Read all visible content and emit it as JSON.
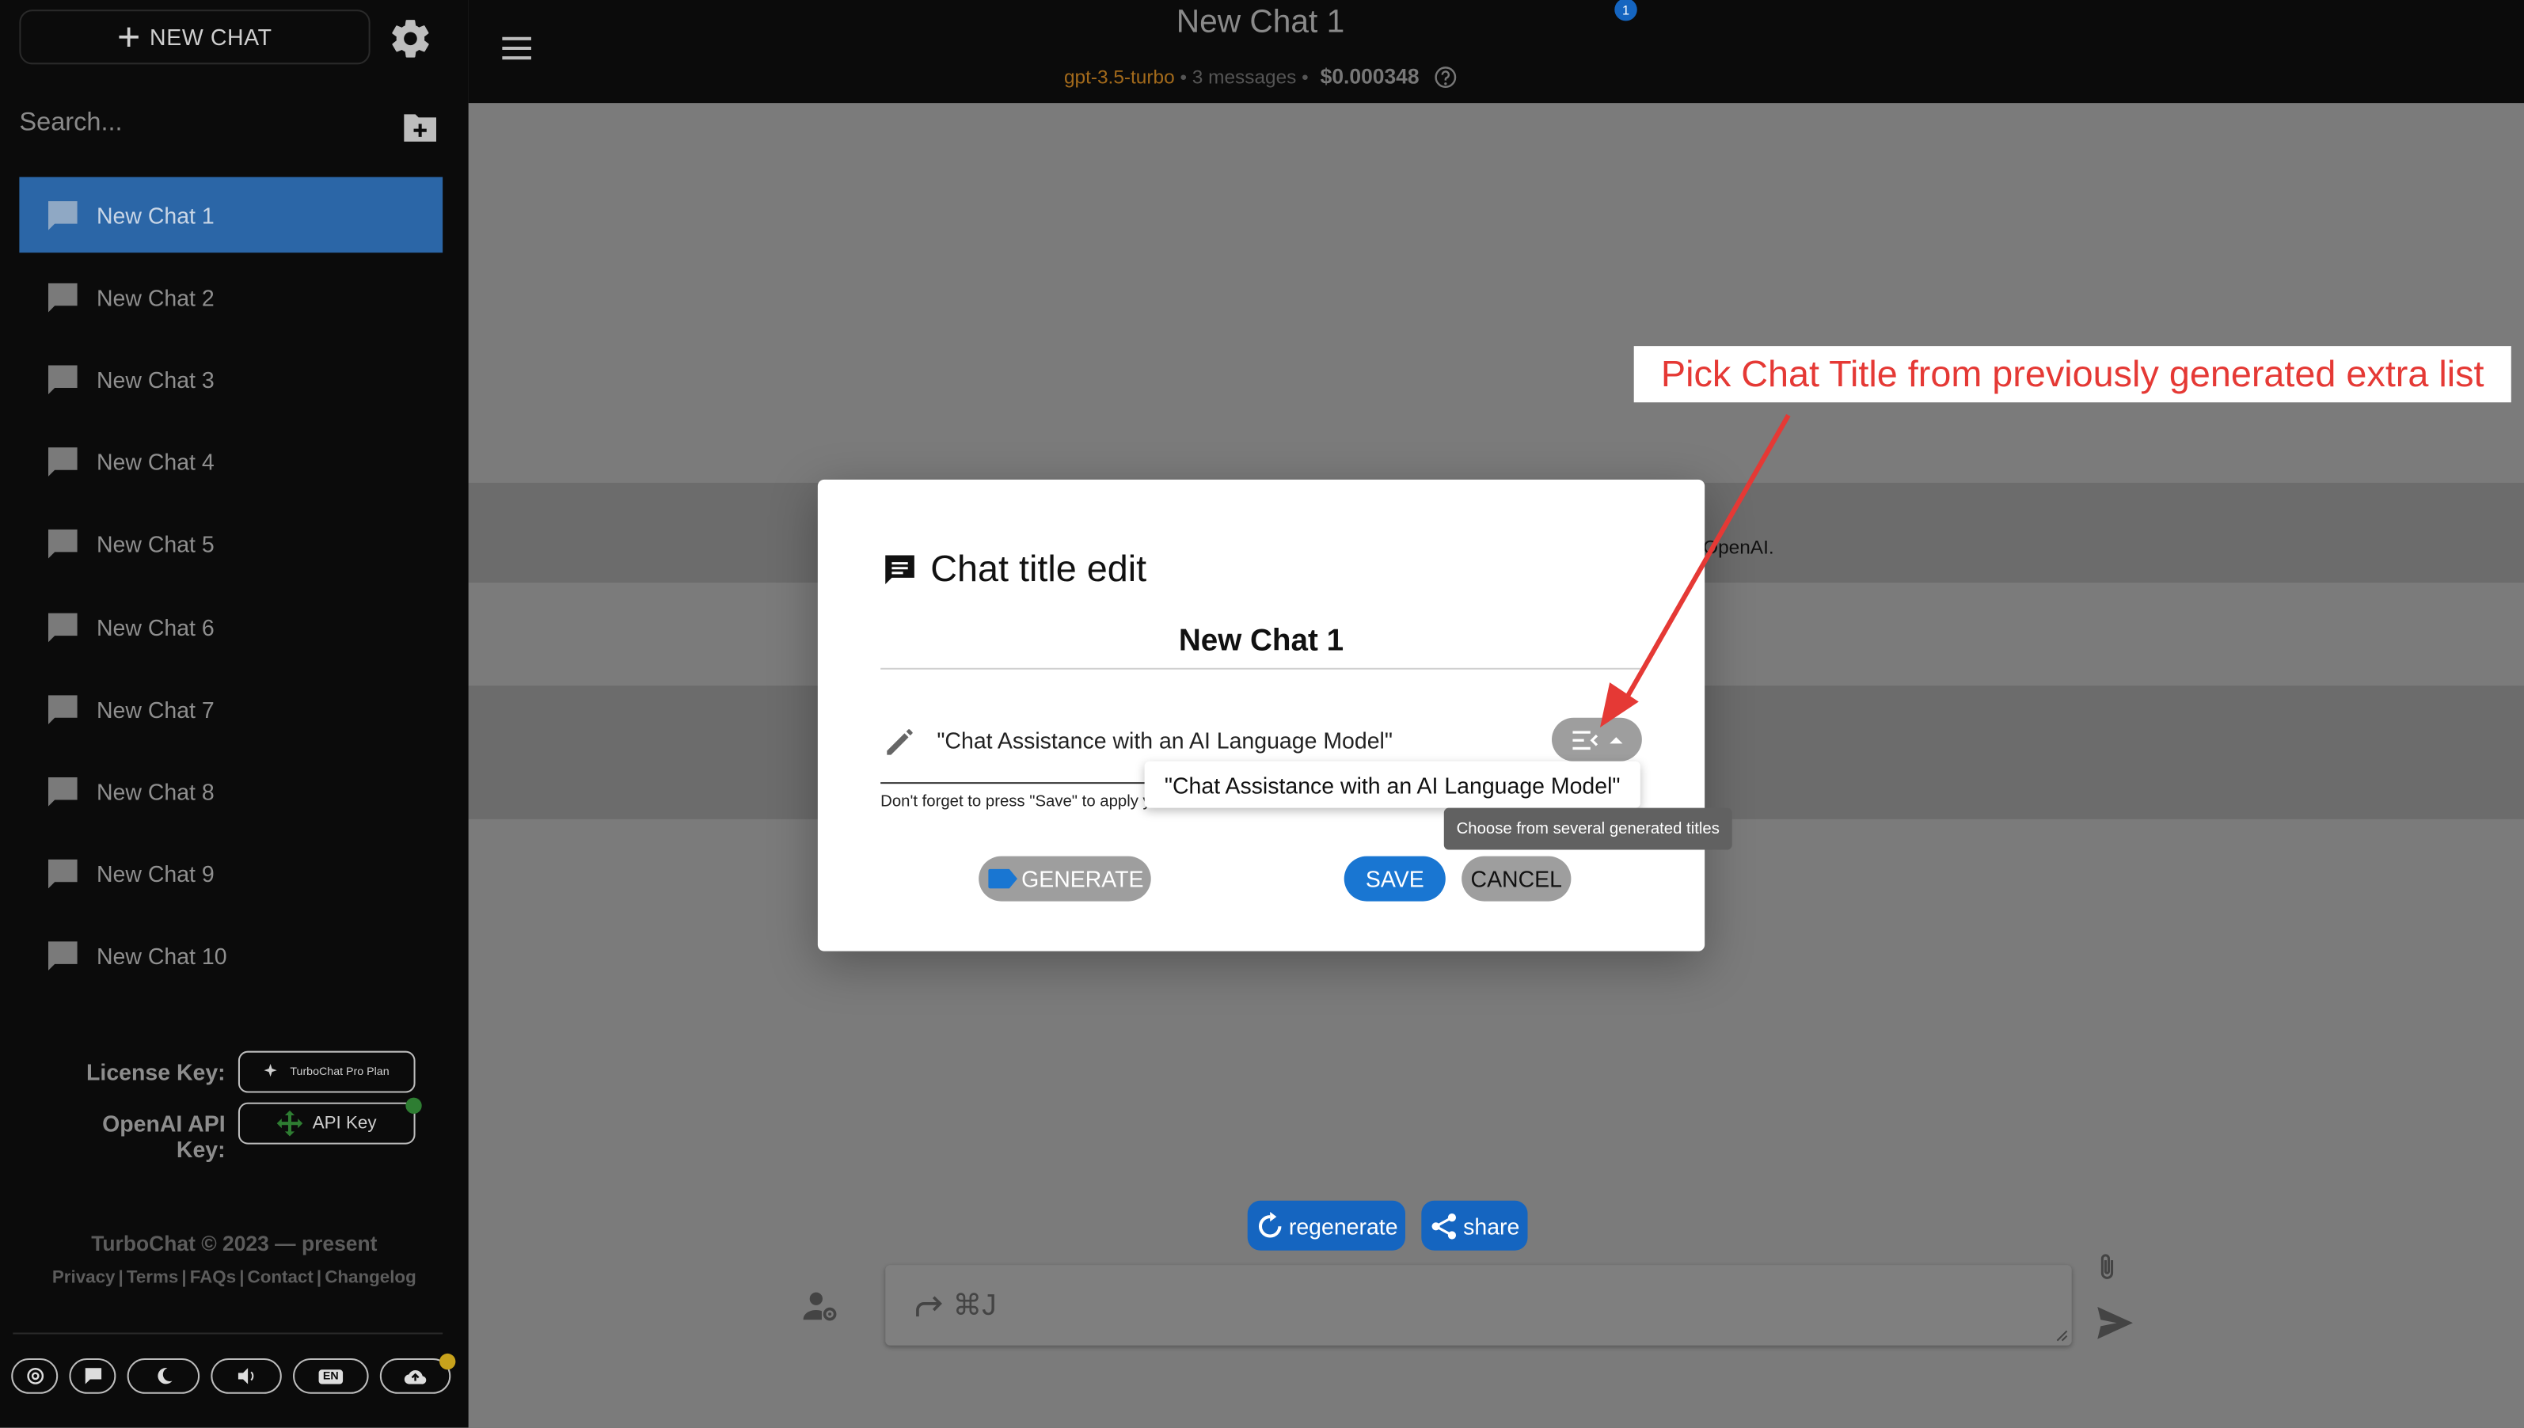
{
  "sidebar": {
    "new_chat_label": "NEW CHAT",
    "search_placeholder": "Search...",
    "chats": [
      "New Chat 1",
      "New Chat 2",
      "New Chat 3",
      "New Chat 4",
      "New Chat 5",
      "New Chat 6",
      "New Chat 7",
      "New Chat 8",
      "New Chat 9",
      "New Chat 10"
    ],
    "active_chat_index": 0,
    "license_key_label": "License Key:",
    "license_key_button": "TurboChat Pro Plan",
    "openai_key_label": "OpenAI API Key:",
    "openai_key_button": "API Key",
    "copyright": "TurboChat © 2023 — present",
    "footer_links": [
      "Privacy",
      "Terms",
      "FAQs",
      "Contact",
      "Changelog"
    ],
    "bottom_icons": [
      "at-icon",
      "chat-icon",
      "moon-icon",
      "volume-icon",
      "language-icon",
      "cloud-upload-icon"
    ],
    "language_code": "EN"
  },
  "header": {
    "title": "New Chat 1",
    "badge": "1",
    "model": "gpt-3.5-turbo",
    "messages": "3 messages",
    "cost": "$0.000348"
  },
  "content": {
    "openai_fragment": "OpenAI."
  },
  "dialog": {
    "title": "Chat title edit",
    "chat_name": "New Chat 1",
    "title_value": "\"Chat Assistance with an AI Language Model\"",
    "hint": "Don't forget to press \"Save\" to apply your changes",
    "dropdown_option": "\"Chat Assistance with an AI Language Model\"",
    "tooltip": "Choose from several generated titles",
    "generate_label": "GENERATE",
    "save_label": "SAVE",
    "cancel_label": "CANCEL"
  },
  "annotation": {
    "text": "Pick Chat Title from previously generated extra list",
    "color": "#e53935"
  },
  "bottom": {
    "regenerate_label": "regenerate",
    "share_label": "share",
    "input_placeholder": "⌘J"
  },
  "colors": {
    "accent": "#1976d2",
    "active_chat": "#2b66a7",
    "sidebar_bg": "#0b0b0b",
    "status_dot": "#2e7d32",
    "update_dot": "#c8a21c"
  }
}
